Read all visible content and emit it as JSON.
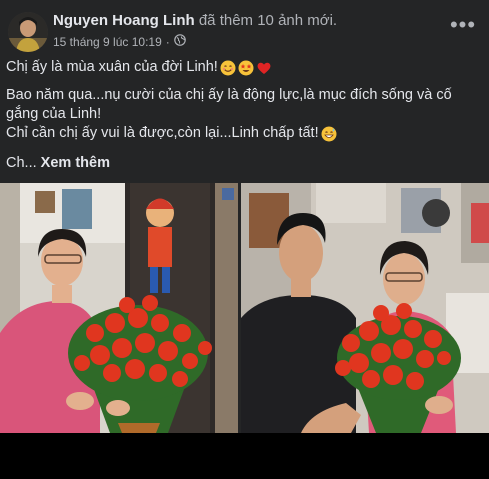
{
  "post": {
    "author": "Nguyen Hoang Linh",
    "action": "đã thêm 10 ảnh mới.",
    "timestamp": "15 tháng 9 lúc 10:19",
    "separator": "·",
    "privacy_icon": "globe-icon",
    "more_icon": "more-options-icon",
    "more_label": "•••",
    "text": {
      "line1": "Chị ấy là mùa xuân của đời Linh!",
      "line2": "Bao năm qua...nụ cười của chị ấy là động lực,là mục đích sống và cố gắng của Linh!",
      "line3": "Chỉ cần chị ấy vui là được,còn lại...Linh chấp tất!",
      "truncated": "Ch...",
      "see_more": "Xem thêm"
    },
    "emojis": [
      "smiling-face-emoji",
      "star-struck-emoji",
      "red-heart-emoji",
      "grinning-sweat-emoji"
    ],
    "photos": [
      {
        "name": "photo-woman-with-roses"
      },
      {
        "name": "photo-man-and-woman-with-roses"
      }
    ]
  },
  "colors": {
    "card_bg": "#242526",
    "text_primary": "#e4e6eb",
    "text_secondary": "#b0b3b8",
    "rose_red": "#e0361f"
  }
}
